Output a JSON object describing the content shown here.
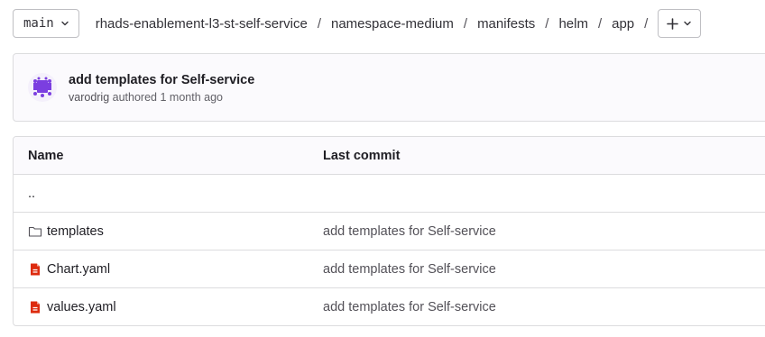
{
  "toolbar": {
    "branch": "main",
    "breadcrumb": [
      "rhads-enablement-l3-st-self-service",
      "namespace-medium",
      "manifests",
      "helm",
      "app"
    ],
    "separator": "/",
    "add_icon": "plus-icon"
  },
  "commit": {
    "title": "add templates for Self-service",
    "author": "varodrig",
    "meta": "authored 1 month ago",
    "avatar_color": "#7b3ee0"
  },
  "table": {
    "headers": {
      "name": "Name",
      "last_commit": "Last commit"
    },
    "parent_link": "..",
    "rows": [
      {
        "name": "templates",
        "icon": "folder-icon",
        "commit": "add templates for Self-service"
      },
      {
        "name": "Chart.yaml",
        "icon": "yaml-file-icon",
        "commit": "add templates for Self-service"
      },
      {
        "name": "values.yaml",
        "icon": "yaml-file-icon",
        "commit": "add templates for Self-service"
      }
    ]
  },
  "colors": {
    "yaml_icon": "#dd2b0e",
    "border": "#dcdcde"
  }
}
